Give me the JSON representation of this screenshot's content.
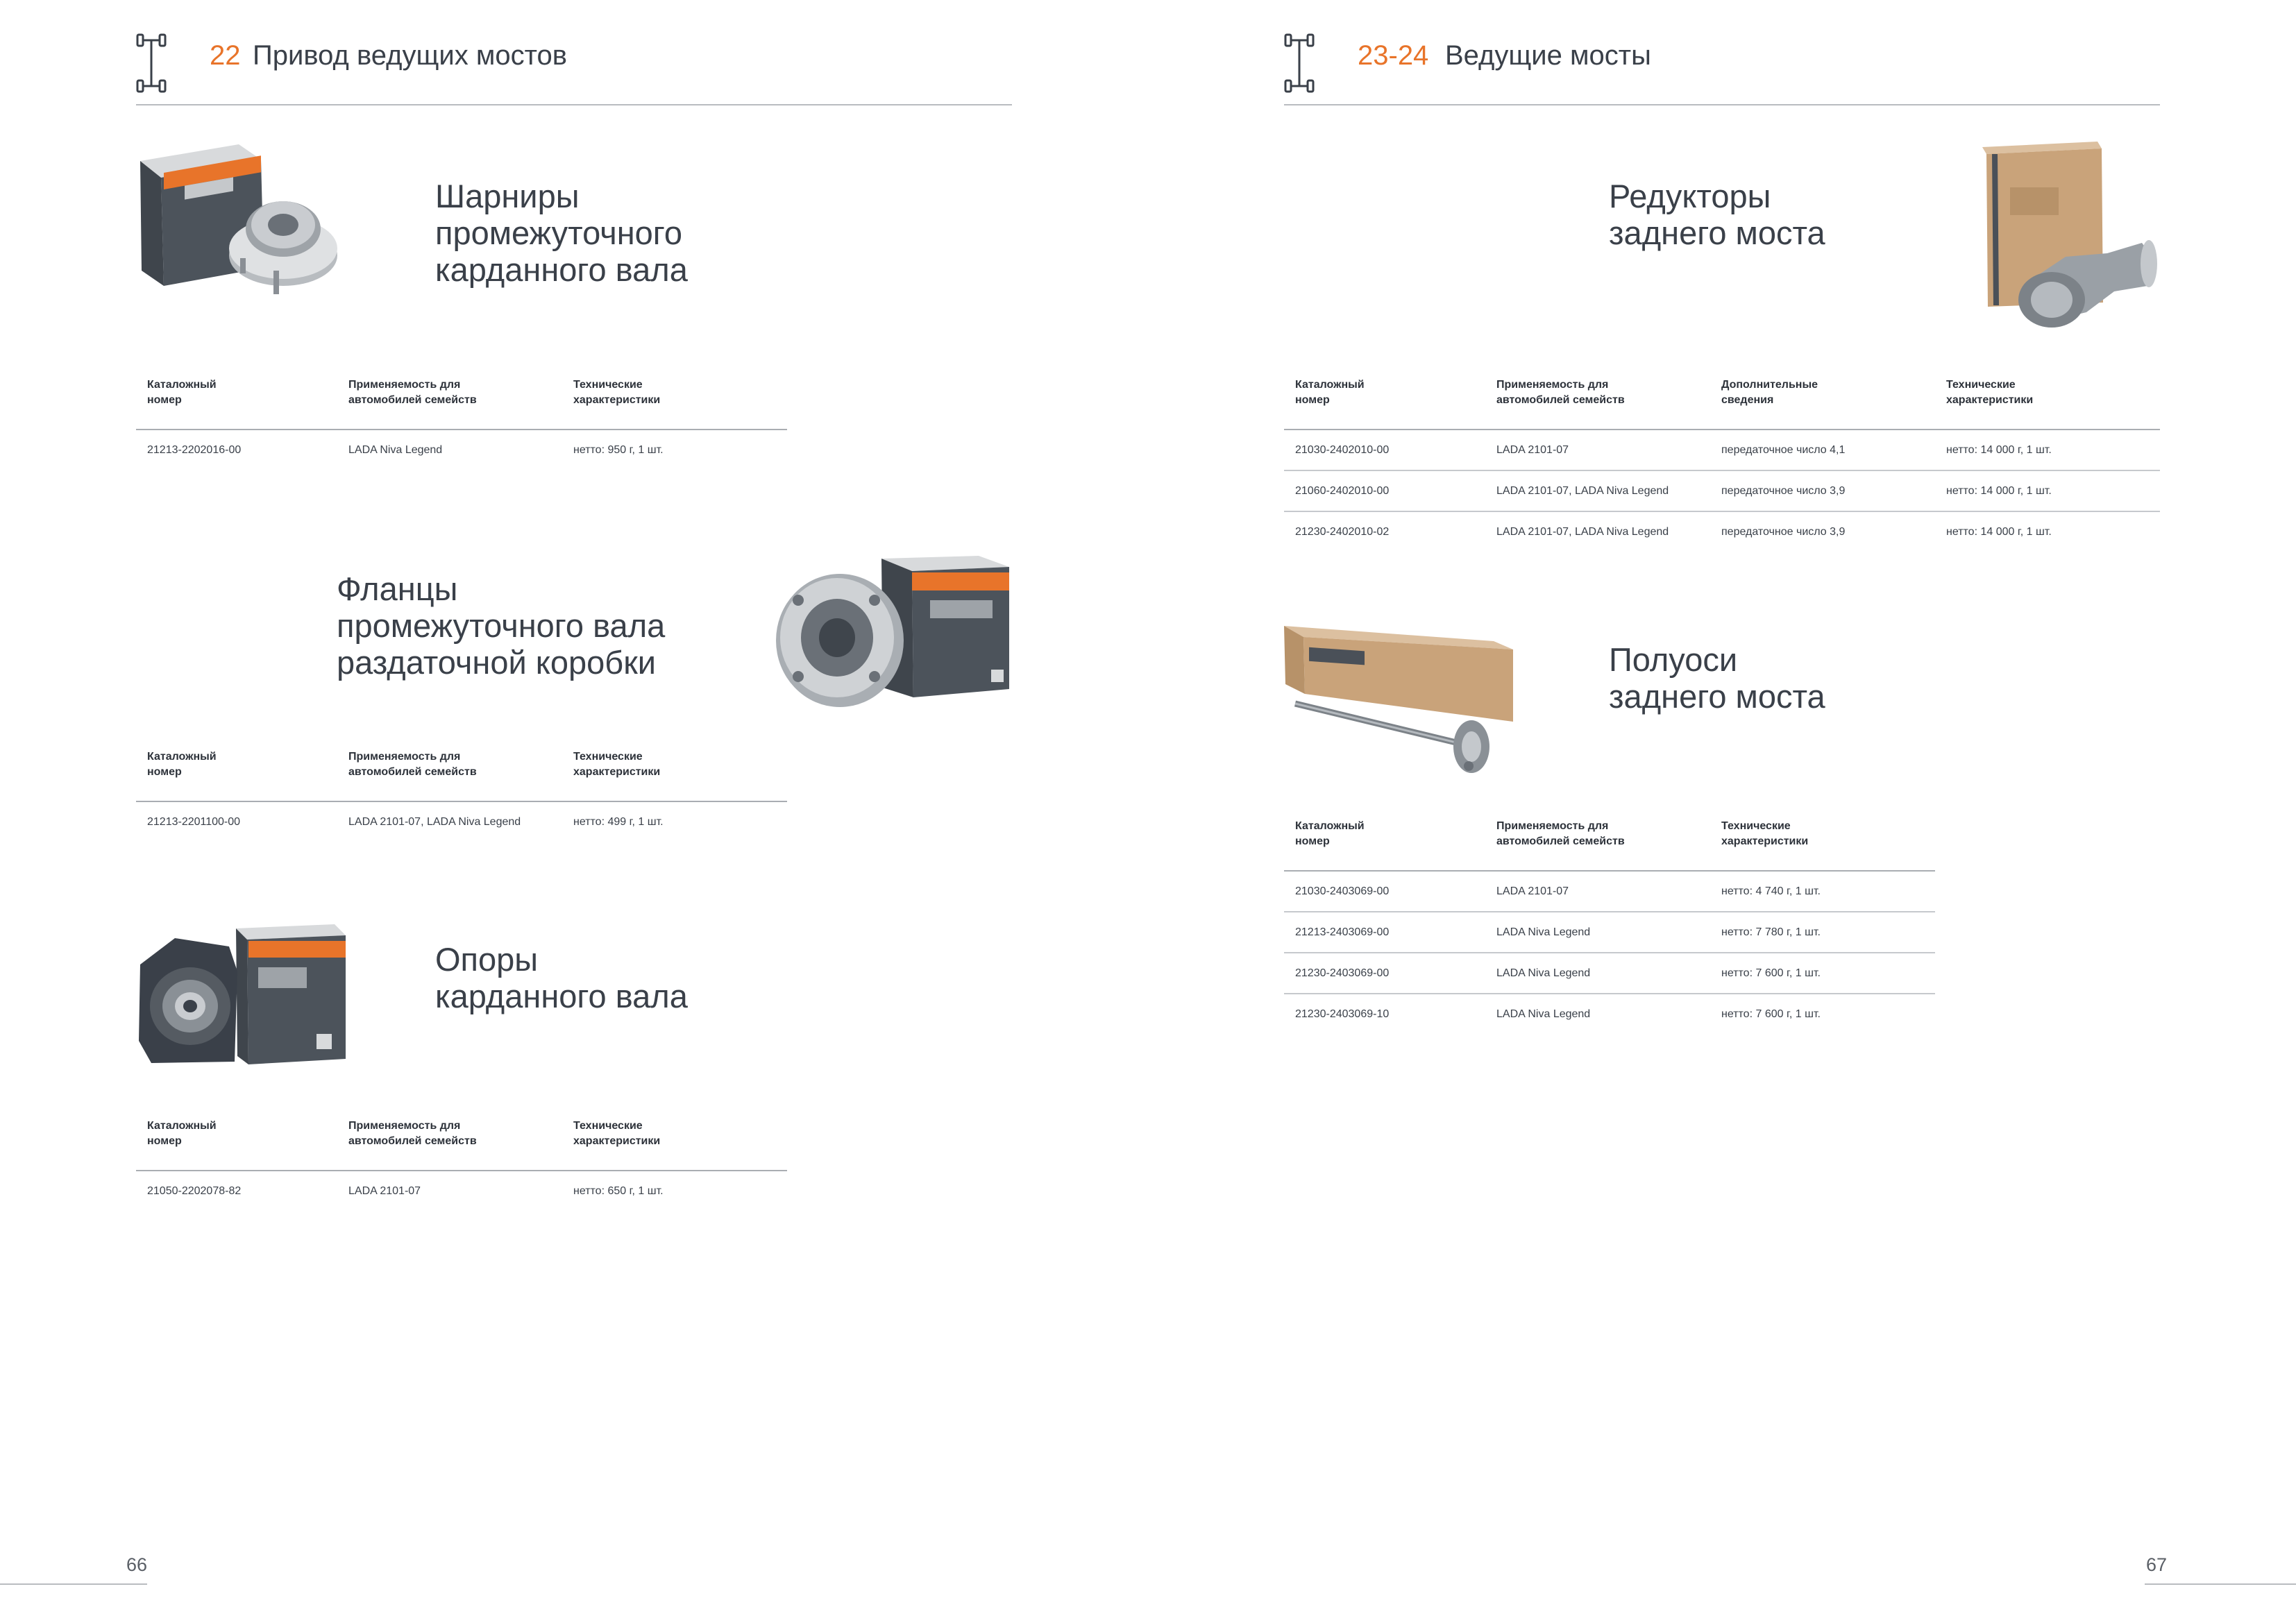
{
  "left_page": {
    "header": {
      "number": "22",
      "title": "Привод ведущих мостов",
      "icon": "axle-icon"
    },
    "page_number": "66",
    "sections": [
      {
        "title": [
          "Шарниры",
          "промежуточного",
          "карданного вала"
        ],
        "headers": [
          [
            "Каталожный",
            "номер"
          ],
          [
            "Применяемость для",
            "автомобилей семейств"
          ],
          [
            "Технические",
            "характеристики"
          ]
        ],
        "rows": [
          [
            "21213-2202016-00",
            "LADA Niva Legend",
            "нетто: 950 г, 1 шт."
          ]
        ]
      },
      {
        "title": [
          "Фланцы",
          "промежуточного вала",
          "раздаточной коробки"
        ],
        "headers": [
          [
            "Каталожный",
            "номер"
          ],
          [
            "Применяемость для",
            "автомобилей семейств"
          ],
          [
            "Технические",
            "характеристики"
          ]
        ],
        "rows": [
          [
            "21213-2201100-00",
            "LADA 2101-07, LADA Niva Legend",
            "нетто: 499 г, 1 шт."
          ]
        ]
      },
      {
        "title": [
          "Опоры",
          "карданного вала"
        ],
        "headers": [
          [
            "Каталожный",
            "номер"
          ],
          [
            "Применяемость для",
            "автомобилей семейств"
          ],
          [
            "Технические",
            "характеристики"
          ]
        ],
        "rows": [
          [
            "21050-2202078-82",
            "LADA 2101-07",
            "нетто: 650 г, 1 шт."
          ]
        ]
      }
    ]
  },
  "right_page": {
    "header": {
      "number": "23-24",
      "title": "Ведущие мосты",
      "icon": "axle-icon"
    },
    "page_number": "67",
    "sections": [
      {
        "title": [
          "Редукторы",
          "заднего моста"
        ],
        "headers": [
          [
            "Каталожный",
            "номер"
          ],
          [
            "Применяемость для",
            "автомобилей семейств"
          ],
          [
            "Дополнительные",
            "сведения"
          ],
          [
            "Технические",
            "характеристики"
          ]
        ],
        "rows": [
          [
            "21030-2402010-00",
            "LADA 2101-07",
            "передаточное число 4,1",
            "нетто: 14 000 г, 1 шт."
          ],
          [
            "21060-2402010-00",
            "LADA 2101-07, LADA Niva Legend",
            "передаточное число 3,9",
            "нетто: 14 000 г, 1 шт."
          ],
          [
            "21230-2402010-02",
            "LADA 2101-07, LADA Niva Legend",
            "передаточное число 3,9",
            "нетто: 14 000 г, 1 шт."
          ]
        ]
      },
      {
        "title": [
          "Полуоси",
          "заднего моста"
        ],
        "headers": [
          [
            "Каталожный",
            "номер"
          ],
          [
            "Применяемость для",
            "автомобилей семейств"
          ],
          [
            "Технические",
            "характеристики"
          ]
        ],
        "rows": [
          [
            "21030-2403069-00",
            "LADA 2101-07",
            "нетто: 4 740 г, 1 шт."
          ],
          [
            "21213-2403069-00",
            "LADA Niva Legend",
            "нетто: 7 780 г, 1 шт."
          ],
          [
            "21230-2403069-00",
            "LADA Niva Legend",
            "нетто: 7 600 г, 1 шт."
          ],
          [
            "21230-2403069-10",
            "LADA Niva Legend",
            "нетто: 7 600 г, 1 шт."
          ]
        ]
      }
    ]
  },
  "colors": {
    "accent": "#e8742a",
    "text": "#3a4049",
    "box_dark": "#4a5058",
    "box_orange": "#e8742a",
    "cardboard": "#c8a47a"
  }
}
